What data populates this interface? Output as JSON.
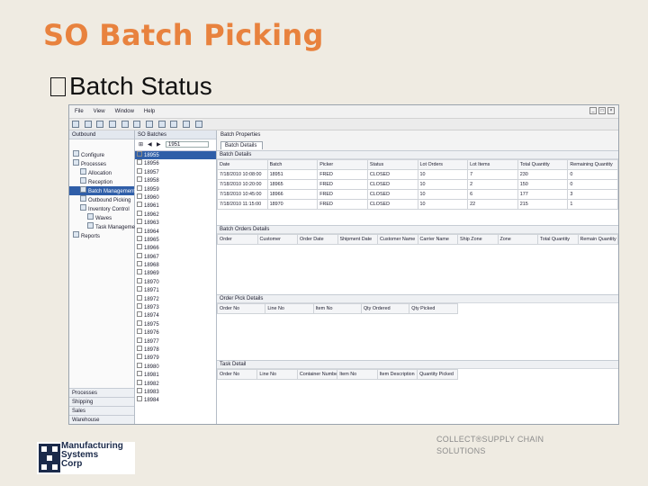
{
  "slide": {
    "title": "SO Batch Picking",
    "bullet": "Batch Status",
    "caption_line1": "COLLECT®SUPPLY CHAIN",
    "caption_line2": "SOLUTIONS"
  },
  "logo": {
    "line1": "Manufacturing",
    "line2": "Systems",
    "line3": "Corp"
  },
  "app": {
    "menu": [
      "File",
      "View",
      "Window",
      "Help"
    ],
    "nav": {
      "header": "Outbound",
      "tree": [
        {
          "label": "Configure",
          "level": 0,
          "selected": false
        },
        {
          "label": "Processes",
          "level": 0,
          "selected": false
        },
        {
          "label": "Allocation",
          "level": 1,
          "selected": false
        },
        {
          "label": "Reception",
          "level": 1,
          "selected": false
        },
        {
          "label": "Batch Management",
          "level": 1,
          "selected": true
        },
        {
          "label": "Outbound Picking",
          "level": 1,
          "selected": false
        },
        {
          "label": "Inventory Control",
          "level": 1,
          "selected": false
        },
        {
          "label": "Waves",
          "level": 2,
          "selected": false
        },
        {
          "label": "Task Management",
          "level": 2,
          "selected": false
        },
        {
          "label": "Reports",
          "level": 0,
          "selected": false
        }
      ],
      "bottom": [
        "Processes",
        "Shipping",
        "Sales",
        "Warehouse"
      ]
    },
    "list": {
      "header": "SO Batches",
      "search_value": "1951",
      "items": [
        "18955",
        "18956",
        "18957",
        "18958",
        "18959",
        "18960",
        "18961",
        "18962",
        "18963",
        "18964",
        "18965",
        "18966",
        "18967",
        "18968",
        "18969",
        "18970",
        "18971",
        "18972",
        "18973",
        "18974",
        "18975",
        "18976",
        "18977",
        "18978",
        "18979",
        "18980",
        "18981",
        "18982",
        "18983",
        "18984"
      ]
    },
    "detail": {
      "header": "Batch Properties",
      "tab": "Batch Details",
      "batch_details": {
        "title": "Batch Details",
        "columns": [
          "Date",
          "Batch",
          "Picker",
          "Status",
          "Lot Orders",
          "Lot Items",
          "Total Quantity",
          "Remaining Quantity"
        ],
        "rows": [
          [
            "7/18/2010 10:08:00",
            "18951",
            "FRED",
            "CLOSED",
            "10",
            "7",
            "230",
            "0"
          ],
          [
            "7/18/2010 10:20:00",
            "18965",
            "FRED",
            "CLOSED",
            "10",
            "2",
            "150",
            "0"
          ],
          [
            "7/18/2010 10:45:00",
            "18966",
            "FRED",
            "CLOSED",
            "10",
            "6",
            "177",
            "3"
          ],
          [
            "7/18/2010 11:15:00",
            "18970",
            "FRED",
            "CLOSED",
            "10",
            "22",
            "215",
            "1"
          ]
        ]
      },
      "batch_orders": {
        "title": "Batch Orders Details",
        "columns": [
          "Order",
          "Customer",
          "Order Date",
          "Shipment Date",
          "Customer Name",
          "Carrier Name",
          "Ship Zone",
          "Zone",
          "Total Quantity",
          "Remain Quantity"
        ]
      },
      "order_picks": {
        "title": "Order Pick Details",
        "columns": [
          "Order No",
          "Line No",
          "Item No",
          "Qty Ordered",
          "Qty Picked"
        ]
      },
      "task_detail": {
        "title": "Task Detail",
        "columns": [
          "Order No",
          "Line No",
          "Container Number",
          "Item No",
          "Item Description",
          "Quantity Picked"
        ]
      }
    }
  }
}
